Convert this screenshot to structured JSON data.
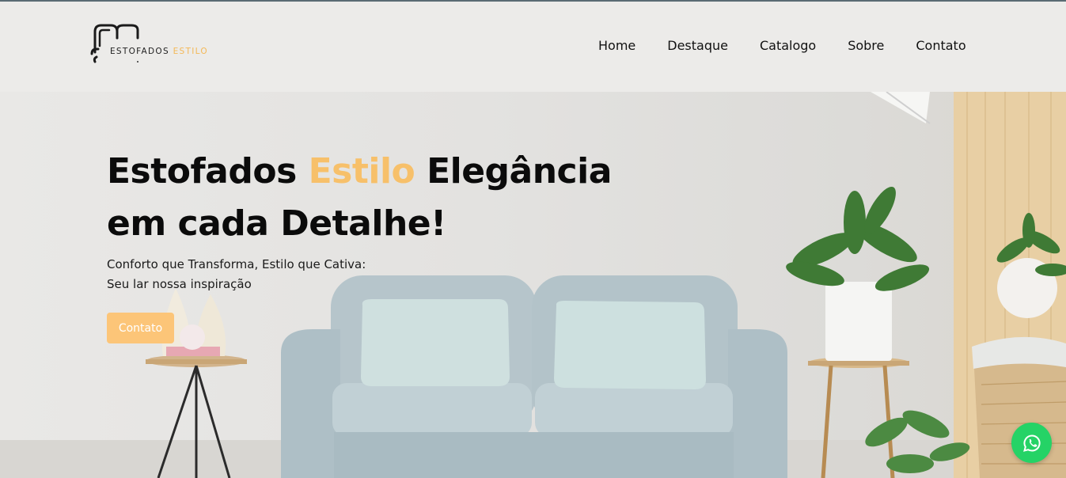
{
  "brand": {
    "logo_word1": "ESTOFADOS",
    "logo_word2": "ESTILO"
  },
  "nav": {
    "items": [
      "Home",
      "Destaque",
      "Catalogo",
      "Sobre",
      "Contato"
    ]
  },
  "hero": {
    "title_part1": "Estofados ",
    "title_accent": "Estilo",
    "title_part2": " Elegância",
    "title_line2": "em cada Detalhe!",
    "subtitle_line1": "Conforto que Transforma, Estilo que Cativa:",
    "subtitle_line2": "Seu lar nossa inspiração",
    "cta_label": "Contato"
  },
  "colors": {
    "accent": "#f7c06a",
    "button": "#fcc578",
    "whatsapp": "#25d366",
    "header_bg": "#ecebe9"
  },
  "icons": {
    "whatsapp": "whatsapp-icon",
    "logo": "sofa-logo-icon"
  }
}
